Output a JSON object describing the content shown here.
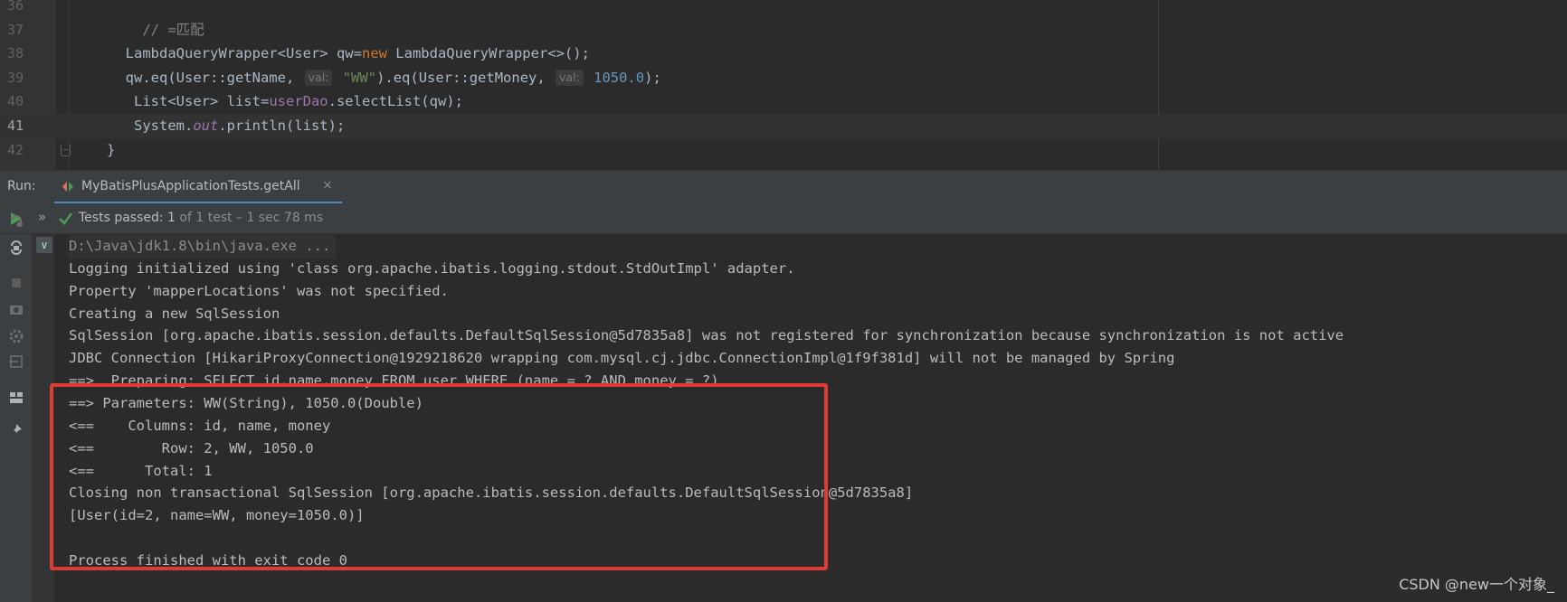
{
  "editor": {
    "lines": [
      {
        "no": "36",
        "parts": []
      },
      {
        "no": "37",
        "parts": [
          {
            "t": "    "
          },
          {
            "c": "comment",
            "t": "// =匹配"
          }
        ]
      },
      {
        "no": "38",
        "parts": [
          {
            "t": "  LambdaQueryWrapper<User> qw="
          },
          {
            "c": "kw",
            "t": "new"
          },
          {
            "t": " LambdaQueryWrapper<>();"
          }
        ]
      },
      {
        "no": "39",
        "parts": [
          {
            "t": "  qw.eq(User::getName, "
          },
          {
            "c": "hint",
            "t": "val:"
          },
          {
            "c": "str",
            "t": " \"WW\""
          },
          {
            "t": ").eq(User::getMoney, "
          },
          {
            "c": "hint",
            "t": "val:"
          },
          {
            "c": "num",
            "t": " 1050.0"
          },
          {
            "t": ");"
          }
        ]
      },
      {
        "no": "40",
        "parts": [
          {
            "t": "   List<User> list="
          },
          {
            "c": "field",
            "t": "userDao"
          },
          {
            "t": ".selectList(qw);"
          }
        ]
      },
      {
        "no": "41",
        "current": true,
        "parts": [
          {
            "t": "   System."
          },
          {
            "c": "static",
            "t": "out"
          },
          {
            "t": ".println(list);"
          }
        ]
      },
      {
        "no": "42",
        "parts": [
          {
            "t": "}"
          }
        ]
      }
    ]
  },
  "run_bar": {
    "label": "Run:",
    "tab_label": "MyBatisPlusApplicationTests.getAll",
    "close_glyph": "×"
  },
  "toolbar": {
    "chevron": "»",
    "tests_status": "Tests passed:",
    "tests_count": "1",
    "tests_detail": "of 1 test – 1 sec 78 ms"
  },
  "console": {
    "collapse_glyph": "∨",
    "lines": [
      "D:\\Java\\jdk1.8\\bin\\java.exe ...",
      "Logging initialized using 'class org.apache.ibatis.logging.stdout.StdOutImpl' adapter.",
      "Property 'mapperLocations' was not specified.",
      "Creating a new SqlSession",
      "SqlSession [org.apache.ibatis.session.defaults.DefaultSqlSession@5d7835a8] was not registered for synchronization because synchronization is not active",
      "JDBC Connection [HikariProxyConnection@1929218620 wrapping com.mysql.cj.jdbc.ConnectionImpl@1f9f381d] will not be managed by Spring",
      "==>  Preparing: SELECT id,name,money FROM user WHERE (name = ? AND money = ?)",
      "==> Parameters: WW(String), 1050.0(Double)",
      "<==    Columns: id, name, money",
      "<==        Row: 2, WW, 1050.0",
      "<==      Total: 1",
      "Closing non transactional SqlSession [org.apache.ibatis.session.defaults.DefaultSqlSession@5d7835a8]",
      "[User(id=2, name=WW, money=1050.0)]",
      "",
      "Process finished with exit code 0"
    ]
  },
  "watermark": "CSDN @new一个对象_",
  "colors": {
    "accent_tab": "#4a88c7",
    "pass_green": "#499c54",
    "highlight_red": "#e03a36"
  },
  "icons": {
    "run_tab": "test-run-icon",
    "play": "play-icon",
    "check": "check-icon",
    "side": [
      "rerun-failed-icon",
      "toggle-auto-test-icon",
      "stop-icon",
      "screenshot-icon",
      "settings-icon",
      "exit-icon",
      "layout-icon",
      "pin-icon"
    ]
  }
}
